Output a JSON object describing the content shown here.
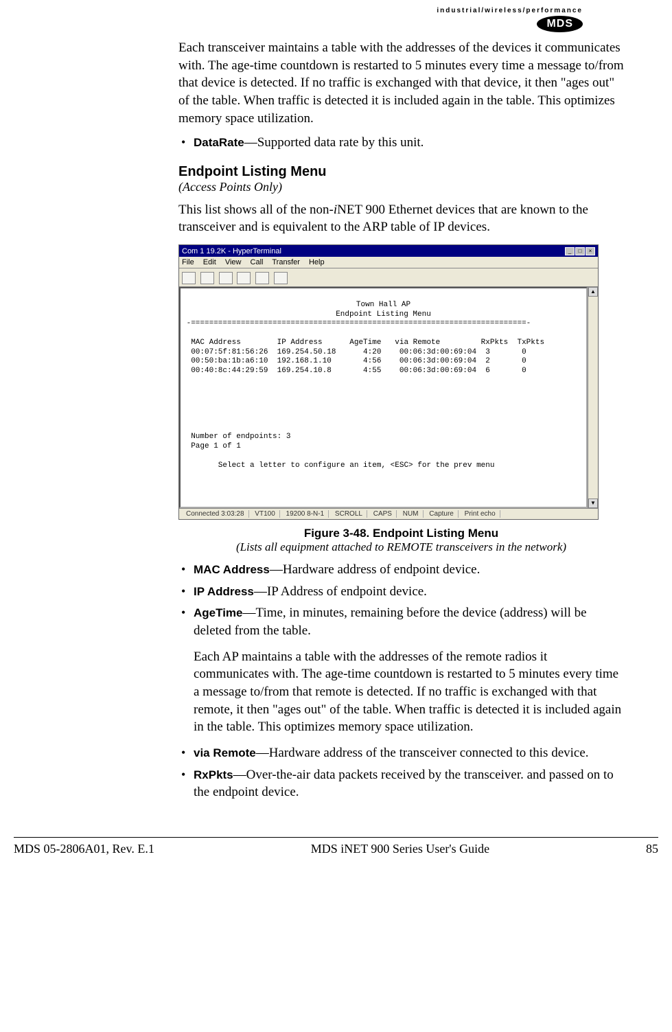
{
  "logo": {
    "tagline": "industrial/wireless/performance",
    "label": "MDS"
  },
  "intro_para": "Each transceiver maintains a table with the addresses of the devices it communicates with. The age-time countdown is restarted to 5 minutes every time a message to/from that device is detected. If no traffic is exchanged with that device, it then \"ages out\" of the table. When traffic is detected it is included again in the table. This optimizes memory space utilization.",
  "bullet_top": {
    "term": "DataRate",
    "desc": "—Supported data rate by this unit."
  },
  "section": {
    "title": "Endpoint Listing Menu",
    "subtitle": "(Access Points Only)"
  },
  "section_para_prefix": "This list shows all of the non-",
  "section_para_i": "i",
  "section_para_suffix": "NET 900 Ethernet devices that are known to the transceiver and is equivalent to the ARP table of IP devices.",
  "terminal": {
    "title": "Com 1 19.2K - HyperTerminal",
    "menus": [
      "File",
      "Edit",
      "View",
      "Call",
      "Transfer",
      "Help"
    ],
    "screen_title1": "Town Hall AP",
    "screen_title2": "Endpoint Listing Menu",
    "header_row": "  MAC Address        IP Address      AgeTime   via Remote         RxPkts  TxPkts",
    "rows": [
      "  00:07:5f:81:56:26  169.254.50.18      4:20    00:06:3d:00:69:04  3       0",
      "  00:50:ba:1b:a6:10  192.168.1.10       4:56    00:06:3d:00:69:04  2       0",
      "  00:40:8c:44:29:59  169.254.10.8       4:55    00:06:3d:00:69:04  6       0"
    ],
    "footer_line1": "  Number of endpoints: 3",
    "footer_line2": "  Page 1 of 1",
    "prompt": "        Select a letter to configure an item, <ESC> for the prev menu",
    "status": [
      "Connected 3:03:28",
      "VT100",
      "19200 8-N-1",
      "SCROLL",
      "CAPS",
      "NUM",
      "Capture",
      "Print echo"
    ]
  },
  "figure": {
    "caption": "Figure 3-48. Endpoint Listing Menu",
    "subcaption": "(Lists all equipment attached to REMOTE transceivers in the network)"
  },
  "defs": {
    "mac": {
      "term": "MAC Address",
      "desc": "—Hardware address of endpoint device."
    },
    "ip": {
      "term": "IP Address",
      "desc": "—IP Address of endpoint device."
    },
    "age": {
      "term": "AgeTime",
      "desc": "—Time, in minutes, remaining before the device (address) will be deleted from the table."
    },
    "age_para": "Each AP maintains a table with the addresses of the remote radios it communicates with. The age-time countdown is restarted to 5 minutes every time a message to/from that remote is detected. If no traffic is exchanged with that remote, it then \"ages out\" of the table. When traffic is detected it is included again in the table. This optimizes memory space utilization.",
    "via": {
      "term": "via Remote",
      "desc": "—Hardware address of the transceiver connected to this device."
    },
    "rx": {
      "term": "RxPkts",
      "desc": "—Over-the-air data packets received by the transceiver. and passed on to the endpoint device."
    }
  },
  "footer": {
    "left": "MDS 05-2806A01, Rev. E.1",
    "center": "MDS iNET 900 Series User's Guide",
    "right": "85"
  }
}
